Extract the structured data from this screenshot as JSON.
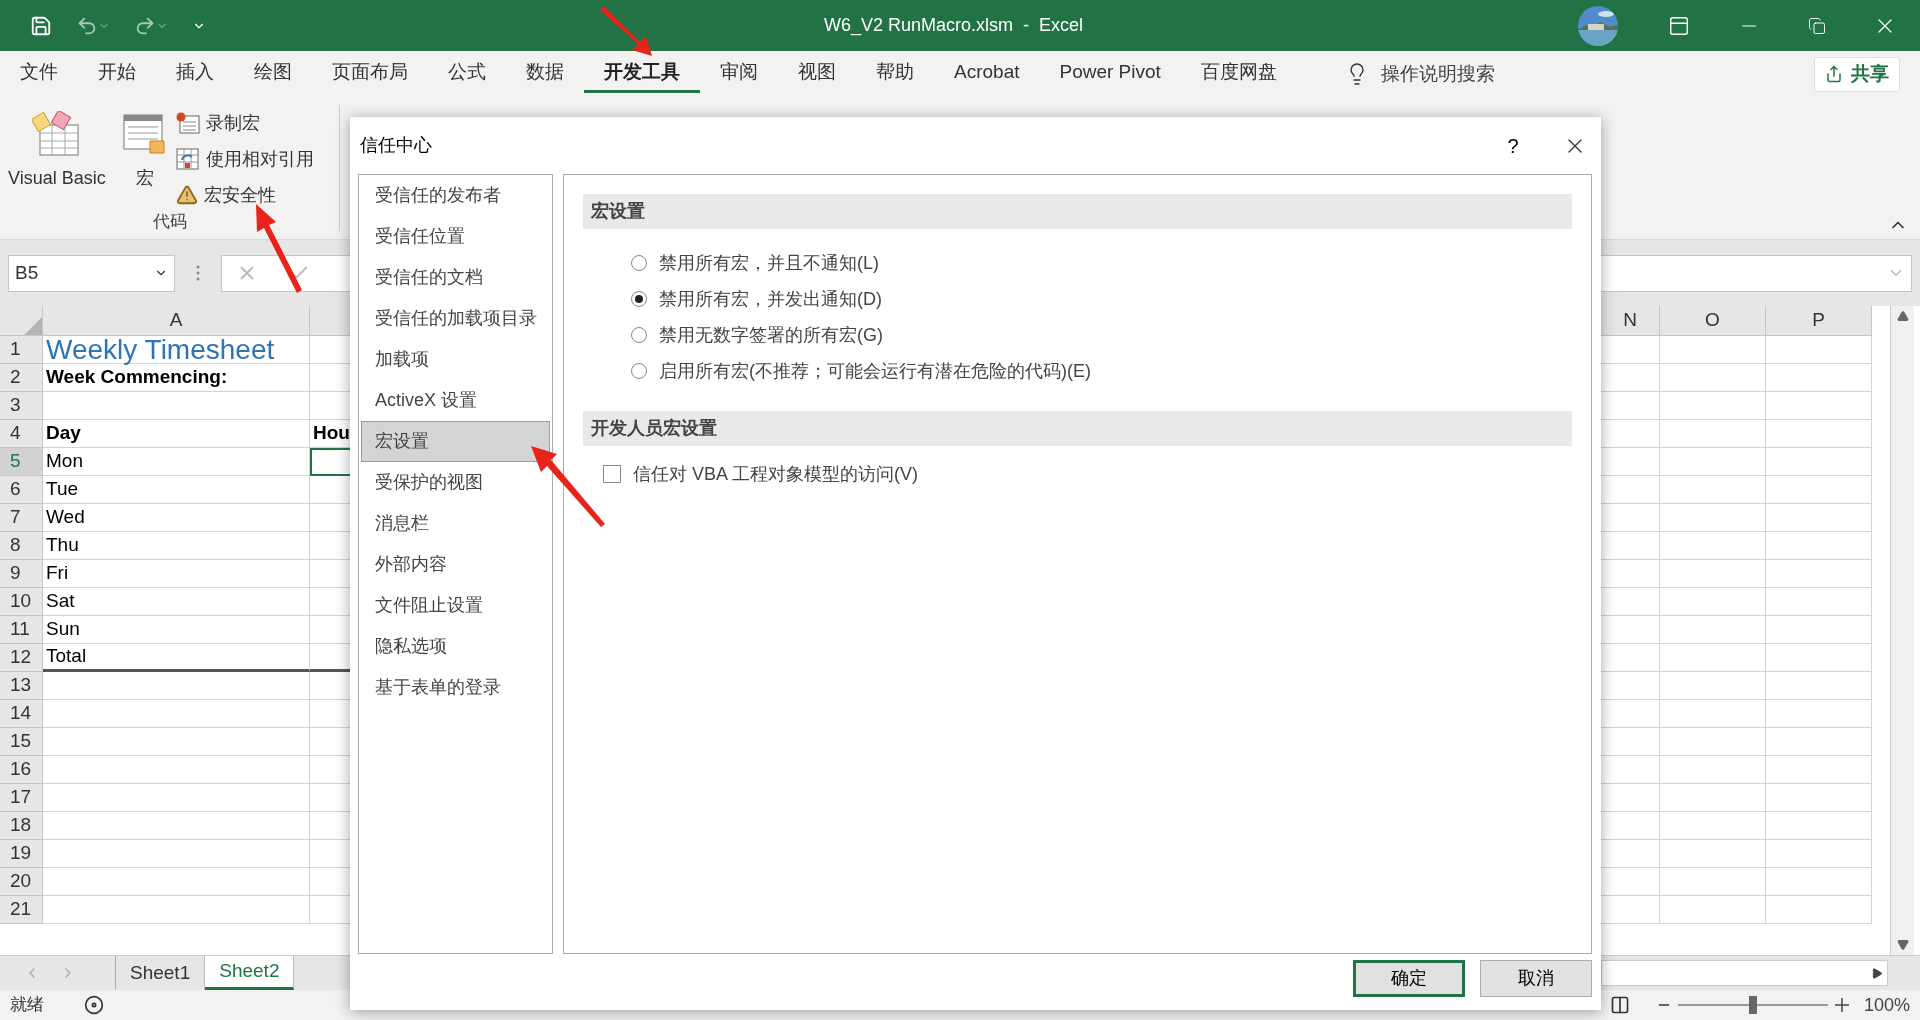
{
  "window": {
    "title": "W6_V2 RunMacro.xlsm  -  Excel"
  },
  "ribbon_tabs": [
    {
      "label": "文件",
      "selected": false
    },
    {
      "label": "开始",
      "selected": false
    },
    {
      "label": "插入",
      "selected": false
    },
    {
      "label": "绘图",
      "selected": false
    },
    {
      "label": "页面布局",
      "selected": false
    },
    {
      "label": "公式",
      "selected": false
    },
    {
      "label": "数据",
      "selected": false
    },
    {
      "label": "开发工具",
      "selected": true
    },
    {
      "label": "审阅",
      "selected": false
    },
    {
      "label": "视图",
      "selected": false
    },
    {
      "label": "帮助",
      "selected": false
    },
    {
      "label": "Acrobat",
      "selected": false
    },
    {
      "label": "Power Pivot",
      "selected": false
    },
    {
      "label": "百度网盘",
      "selected": false
    }
  ],
  "tell_me": {
    "placeholder": "操作说明搜索"
  },
  "share_button": "共享",
  "ribbon_group": {
    "label": "代码",
    "buttons": [
      {
        "kind": "visual-basic",
        "label": "Visual Basic"
      },
      {
        "kind": "macros",
        "label": "宏"
      },
      {
        "kind": "record",
        "label": "录制宏"
      },
      {
        "kind": "relative",
        "label": "使用相对引用"
      },
      {
        "kind": "security",
        "label": "宏安全性"
      }
    ]
  },
  "name_box": {
    "value": "B5"
  },
  "sheet": {
    "column_headers": [
      "A",
      "N",
      "O",
      "P"
    ],
    "rows": [
      {
        "number": "1",
        "kind": "title",
        "cells": [
          "Weekly Timesheet"
        ],
        "selected": false
      },
      {
        "number": "2",
        "kind": "bold",
        "cells": [
          "Week Commencing:"
        ],
        "selected": false
      },
      {
        "number": "3",
        "kind": "plain",
        "cells": [],
        "selected": false
      },
      {
        "number": "4",
        "kind": "bold",
        "cells": [
          "Day",
          "Hou"
        ],
        "selected": false
      },
      {
        "number": "5",
        "kind": "plain",
        "cells": [
          "Mon"
        ],
        "selected": true
      },
      {
        "number": "6",
        "kind": "plain",
        "cells": [
          "Tue"
        ],
        "selected": false
      },
      {
        "number": "7",
        "kind": "plain",
        "cells": [
          "Wed"
        ],
        "selected": false
      },
      {
        "number": "8",
        "kind": "plain",
        "cells": [
          "Thu"
        ],
        "selected": false
      },
      {
        "number": "9",
        "kind": "plain",
        "cells": [
          "Fri"
        ],
        "selected": false
      },
      {
        "number": "10",
        "kind": "plain",
        "cells": [
          "Sat"
        ],
        "selected": false
      },
      {
        "number": "11",
        "kind": "plain",
        "cells": [
          "Sun"
        ],
        "selected": false
      },
      {
        "number": "12",
        "kind": "total",
        "cells": [
          "Total"
        ],
        "selected": false
      },
      {
        "number": "13",
        "kind": "plain",
        "cells": [],
        "selected": false
      },
      {
        "number": "14",
        "kind": "plain",
        "cells": [],
        "selected": false
      },
      {
        "number": "15",
        "kind": "plain",
        "cells": [],
        "selected": false
      },
      {
        "number": "16",
        "kind": "plain",
        "cells": [],
        "selected": false
      },
      {
        "number": "17",
        "kind": "plain",
        "cells": [],
        "selected": false
      },
      {
        "number": "18",
        "kind": "plain",
        "cells": [],
        "selected": false
      },
      {
        "number": "19",
        "kind": "plain",
        "cells": [],
        "selected": false
      },
      {
        "number": "20",
        "kind": "plain",
        "cells": [],
        "selected": false
      },
      {
        "number": "21",
        "kind": "plain",
        "cells": [],
        "selected": false
      }
    ]
  },
  "sheet_tabs": [
    {
      "label": "Sheet1",
      "selected": false
    },
    {
      "label": "Sheet2",
      "selected": true
    }
  ],
  "status_bar": {
    "text": "就绪",
    "zoom": "100%",
    "level": 0.5
  },
  "dialog": {
    "title": "信任中心",
    "help": "?",
    "nav": [
      {
        "label": "受信任的发布者",
        "selected": false
      },
      {
        "label": "受信任位置",
        "selected": false
      },
      {
        "label": "受信任的文档",
        "selected": false
      },
      {
        "label": "受信任的加载项目录",
        "selected": false
      },
      {
        "label": "加载项",
        "selected": false
      },
      {
        "label": "ActiveX 设置",
        "selected": false
      },
      {
        "label": "宏设置",
        "selected": true
      },
      {
        "label": "受保护的视图",
        "selected": false
      },
      {
        "label": "消息栏",
        "selected": false
      },
      {
        "label": "外部内容",
        "selected": false
      },
      {
        "label": "文件阻止设置",
        "selected": false
      },
      {
        "label": "隐私选项",
        "selected": false
      },
      {
        "label": "基于表单的登录",
        "selected": false
      }
    ],
    "sections": [
      {
        "heading": "宏设置",
        "options": [
          {
            "kind": "radio",
            "label": "禁用所有宏，并且不通知(L)",
            "selected": false
          },
          {
            "kind": "radio",
            "label": "禁用所有宏，并发出通知(D)",
            "selected": true
          },
          {
            "kind": "radio",
            "label": "禁用无数字签署的所有宏(G)",
            "selected": false
          },
          {
            "kind": "radio",
            "label": "启用所有宏(不推荐；可能会运行有潜在危险的代码)(E)",
            "selected": false
          }
        ]
      },
      {
        "heading": "开发人员宏设置",
        "options": [
          {
            "kind": "checkbox",
            "label": "信任对 VBA 工程对象模型的访问(V)",
            "checked": false
          }
        ]
      }
    ],
    "buttons": [
      {
        "label": "确定",
        "default": true
      },
      {
        "label": "取消",
        "default": false
      }
    ]
  }
}
